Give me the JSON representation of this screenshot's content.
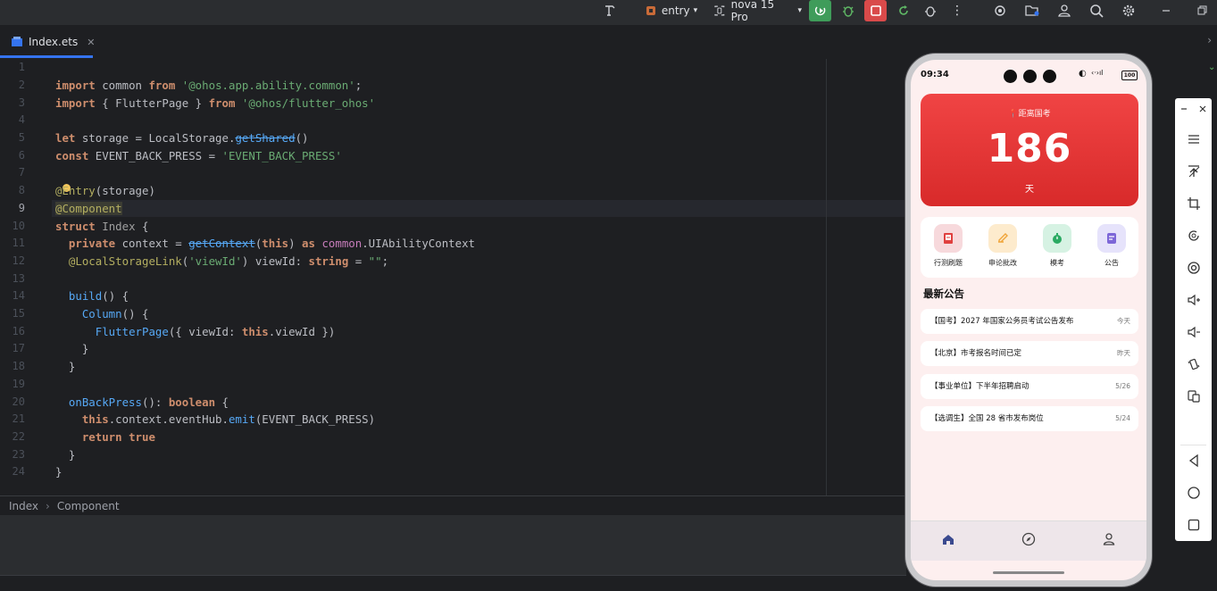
{
  "toolbar": {
    "module": "entry",
    "device": "nova 15 Pro",
    "colors": {
      "run": "#3f9c5a",
      "stop": "#d94a4a"
    },
    "icons": [
      "hammer-icon",
      "module-icon",
      "device-icon",
      "run-icon",
      "debug-icon",
      "stop-icon",
      "apply-changes-icon",
      "profiler-icon",
      "more-icon",
      "target-icon",
      "folder-search-icon",
      "account-icon",
      "search-icon",
      "settings-icon",
      "minimize-icon",
      "restore-icon"
    ]
  },
  "tab": {
    "name": "Index.ets"
  },
  "editor": {
    "line_numbers": [
      "1",
      "2",
      "3",
      "4",
      "5",
      "6",
      "7",
      "8",
      "9",
      "10",
      "11",
      "12",
      "13",
      "14",
      "15",
      "16",
      "17",
      "18",
      "19",
      "20",
      "21",
      "22",
      "23",
      "24"
    ],
    "active_line": "9",
    "lines": {
      "l2": [
        "import",
        " common ",
        "from",
        " ",
        "'@ohos.app.ability.common'",
        ";"
      ],
      "l3": [
        "import",
        " { FlutterPage } ",
        "from",
        " ",
        "'@ohos/flutter_ohos'"
      ],
      "l5": [
        "let",
        " storage = LocalStorage.",
        "getShared",
        "()"
      ],
      "l6": [
        "const",
        " EVENT_BACK_PRESS = ",
        "'EVENT_BACK_PRESS'"
      ],
      "l8": [
        "@Entry",
        "(storage)"
      ],
      "l9": [
        "@Component"
      ],
      "l10": [
        "struct",
        " ",
        "Index",
        " {"
      ],
      "l11": [
        "  ",
        "private",
        " context = ",
        "getContext",
        "(",
        "this",
        ") ",
        "as",
        " ",
        "common",
        ".UIAbilityContext"
      ],
      "l12": [
        "  ",
        "@LocalStorageLink",
        "(",
        "'viewId'",
        ") viewId: ",
        "string",
        " = ",
        "\"\"",
        ";"
      ],
      "l14": [
        "  ",
        "build",
        "() {"
      ],
      "l15": [
        "    ",
        "Column",
        "() {"
      ],
      "l16": [
        "      ",
        "FlutterPage",
        "({ viewId: ",
        "this",
        ".viewId })"
      ],
      "l17": [
        "    }"
      ],
      "l18": [
        "  }"
      ],
      "l20": [
        "  ",
        "onBackPress",
        "(): ",
        "boolean",
        " {"
      ],
      "l21": [
        "    ",
        "this",
        ".context.eventHub.",
        "emit",
        "(EVENT_BACK_PRESS)"
      ],
      "l22": [
        "    ",
        "return",
        " ",
        "true"
      ],
      "l23": [
        "  }"
      ],
      "l24": [
        "}"
      ]
    }
  },
  "breadcrumbs": [
    "Index",
    "Component"
  ],
  "phone": {
    "status_time": "09:34",
    "battery": "100",
    "hero": {
      "label": "距离国考",
      "days": "186",
      "unit": "天"
    },
    "quick": [
      {
        "label": "行测刷题",
        "icon": "practice-icon",
        "color": "#f7d9dc",
        "fg": "#e0403f"
      },
      {
        "label": "申论批改",
        "icon": "pen-icon",
        "color": "#fdebcd",
        "fg": "#f0a53a"
      },
      {
        "label": "模考",
        "icon": "timer-icon",
        "color": "#d6f2e3",
        "fg": "#2aaa62"
      },
      {
        "label": "公告",
        "icon": "notice-icon",
        "color": "#e6e3fb",
        "fg": "#7d67d8"
      }
    ],
    "news_title": "最新公告",
    "news": [
      {
        "title": "【国考】2027 年国家公务员考试公告发布",
        "date": "今天"
      },
      {
        "title": "【北京】市考报名时间已定",
        "date": "昨天"
      },
      {
        "title": "【事业单位】下半年招聘启动",
        "date": "5/26"
      },
      {
        "title": "【选调生】全国 28 省市发布岗位",
        "date": "5/24"
      }
    ],
    "bottom_tabs": [
      "home-icon",
      "compass-icon",
      "profile-icon"
    ],
    "active_color": "#3b4a8f"
  },
  "emulator_bar": [
    "minimize-icon",
    "close-icon",
    "menu-icon",
    "pin-icon",
    "crop-icon",
    "rotate-icon",
    "screenshot-icon",
    "volume-up-icon",
    "volume-down-icon",
    "shake-icon",
    "multi-screen-icon",
    "back-icon",
    "home-icon",
    "recents-icon"
  ]
}
